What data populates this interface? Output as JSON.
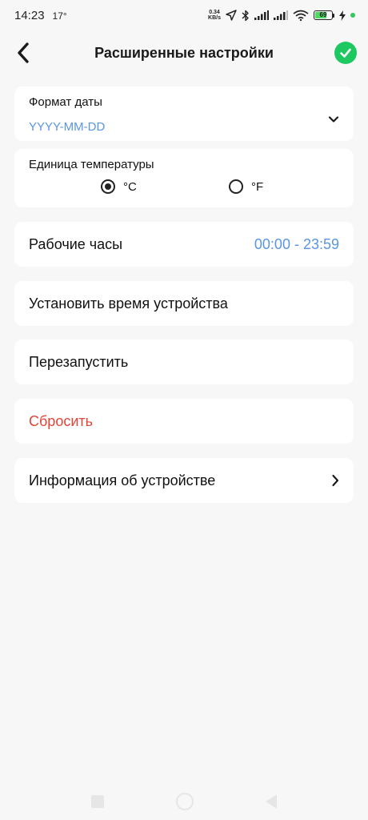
{
  "status_bar": {
    "time": "14:23",
    "temperature": "17°",
    "net_speed_value": "0.34",
    "net_speed_unit": "KB/s",
    "battery_level": "69"
  },
  "header": {
    "title": "Расширенные настройки"
  },
  "date_format": {
    "label": "Формат даты",
    "value": "YYYY-MM-DD"
  },
  "temperature_unit": {
    "label": "Единица температуры",
    "options": [
      {
        "label": "°C",
        "selected": true
      },
      {
        "label": "°F",
        "selected": false
      }
    ]
  },
  "working_hours": {
    "label": "Рабочие часы",
    "value": "00:00 - 23:59"
  },
  "set_device_time": {
    "label": "Установить время устройства"
  },
  "restart": {
    "label": "Перезапустить"
  },
  "reset": {
    "label": "Сбросить",
    "color": "#e0453a"
  },
  "device_info": {
    "label": "Информация об устройстве"
  },
  "colors": {
    "accent_blue": "#5a95e0",
    "confirm_green": "#1cc85f",
    "background": "#f7f7f7"
  },
  "icons": {
    "back": "chevron-left-icon",
    "confirm": "check-circle-icon",
    "dropdown": "chevron-down-icon",
    "info_arrow": "chevron-right-icon"
  }
}
